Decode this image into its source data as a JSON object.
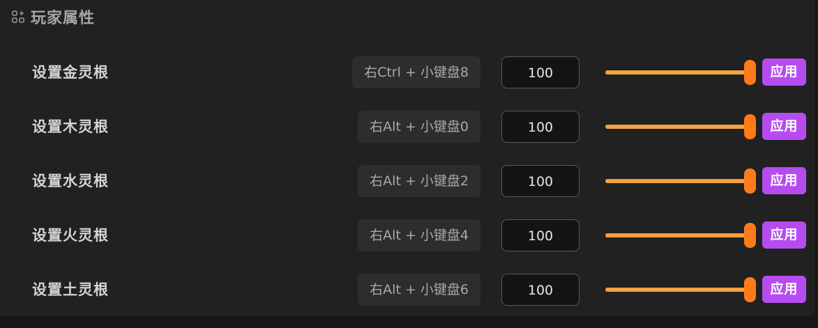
{
  "section": {
    "title": "玩家属性",
    "icon": "grid-plus-icon"
  },
  "rows": [
    {
      "label": "设置金灵根",
      "hotkey": "右Ctrl + 小键盘8",
      "value": "100",
      "slider_level": 1.0,
      "apply_label": "应用"
    },
    {
      "label": "设置木灵根",
      "hotkey": "右Alt + 小键盘0",
      "value": "100",
      "slider_level": 1.0,
      "apply_label": "应用"
    },
    {
      "label": "设置水灵根",
      "hotkey": "右Alt + 小键盘2",
      "value": "100",
      "slider_level": 1.0,
      "apply_label": "应用"
    },
    {
      "label": "设置火灵根",
      "hotkey": "右Alt + 小键盘4",
      "value": "100",
      "slider_level": 1.0,
      "apply_label": "应用"
    },
    {
      "label": "设置土灵根",
      "hotkey": "右Alt + 小键盘6",
      "value": "100",
      "slider_level": 1.0,
      "apply_label": "应用"
    }
  ],
  "colors": {
    "accent_button": "#b64cf0",
    "slider_fill": "#f5a13f",
    "slider_thumb": "#ff7b1a"
  }
}
